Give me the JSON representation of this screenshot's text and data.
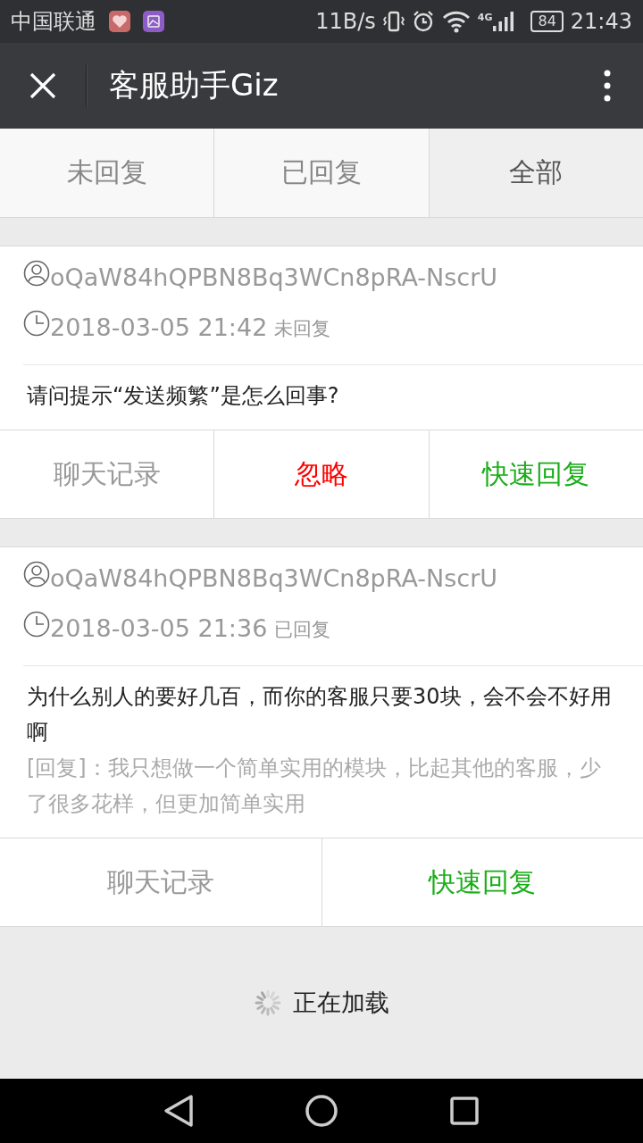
{
  "status_bar": {
    "carrier": "中国联通",
    "speed": "11B/s",
    "network": "4G",
    "battery": "84",
    "time": "21:43"
  },
  "header": {
    "title": "客服助手Giz"
  },
  "tabs": [
    {
      "label": "未回复",
      "selected": false
    },
    {
      "label": "已回复",
      "selected": false
    },
    {
      "label": "全部",
      "selected": true
    }
  ],
  "messages": [
    {
      "user": "oQaW84hQPBN8Bq3WCn8pRA-NscrU",
      "time": "2018-03-05 21:42",
      "status": "未回复",
      "text": "请问提示“发送频繁”是怎么回事?",
      "actions": [
        {
          "label": "聊天记录",
          "kind": "history"
        },
        {
          "label": "忽略",
          "kind": "ignore"
        },
        {
          "label": "快速回复",
          "kind": "reply"
        }
      ]
    },
    {
      "user": "oQaW84hQPBN8Bq3WCn8pRA-NscrU",
      "time": "2018-03-05 21:36",
      "status": "已回复",
      "text": "为什么别人的要好几百，而你的客服只要30块，会不会不好用啊",
      "reply": "[回复]：我只想做一个简单实用的模块，比起其他的客服，少了很多花样，但更加简单实用",
      "actions": [
        {
          "label": "聊天记录",
          "kind": "history"
        },
        {
          "label": "快速回复",
          "kind": "reply"
        }
      ]
    }
  ],
  "loading": {
    "text": "正在加载"
  }
}
